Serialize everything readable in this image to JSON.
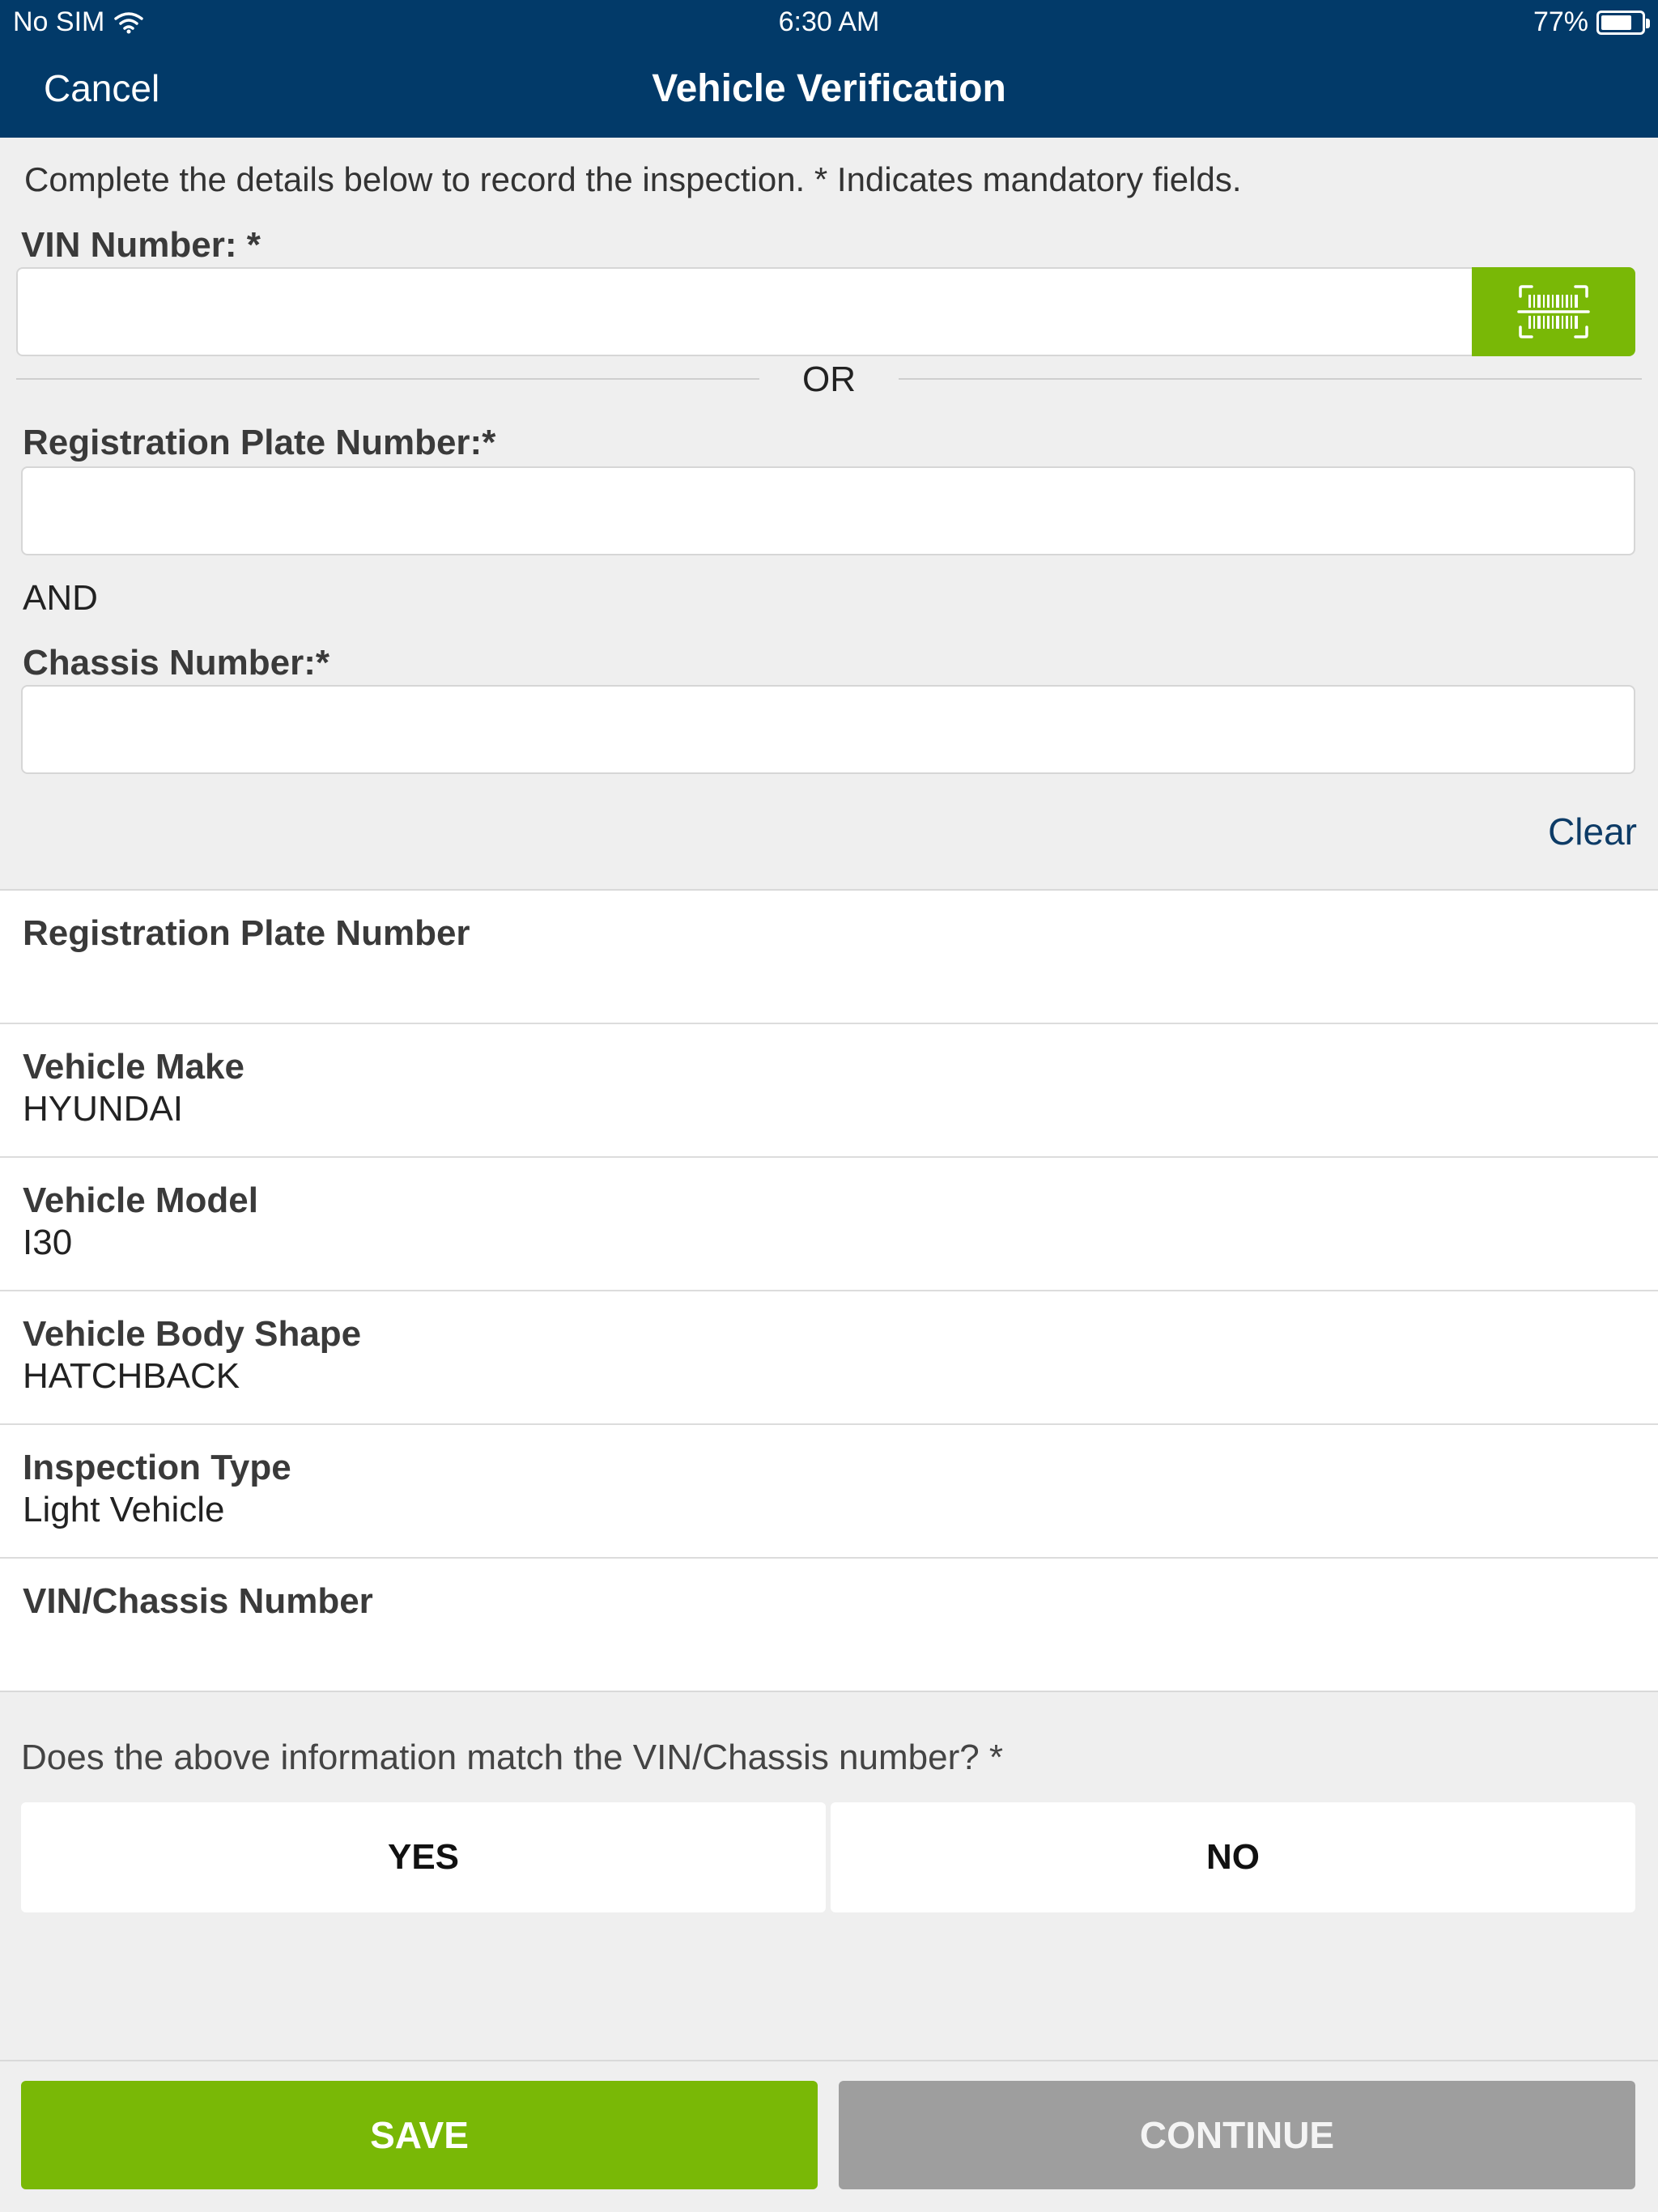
{
  "status_bar": {
    "carrier": "No SIM",
    "time": "6:30 AM",
    "battery": "77%",
    "battery_level": 0.77
  },
  "nav": {
    "cancel_label": "Cancel",
    "title": "Vehicle Verification"
  },
  "form": {
    "intro": "Complete the details below to record the inspection.  * Indicates mandatory fields.",
    "vin_label": "VIN Number: *",
    "vin_value": "",
    "or_text": "OR",
    "rego_label": "Registration Plate Number:*",
    "rego_value": "",
    "and_text": "AND",
    "chassis_label": "Chassis Number:*",
    "chassis_value": "",
    "clear_label": "Clear",
    "scan_icon": "barcode-scan-icon"
  },
  "info": {
    "rows": [
      {
        "label": "Registration Plate Number",
        "value": ""
      },
      {
        "label": "Vehicle Make",
        "value": "HYUNDAI"
      },
      {
        "label": "Vehicle Model",
        "value": "I30"
      },
      {
        "label": "Vehicle Body Shape",
        "value": "HATCHBACK"
      },
      {
        "label": "Inspection Type",
        "value": "Light Vehicle"
      },
      {
        "label": "VIN/Chassis Number",
        "value": ""
      }
    ]
  },
  "question": {
    "text": "Does the above information match the VIN/Chassis number? *",
    "yes_label": "YES",
    "no_label": "NO"
  },
  "actions": {
    "save_label": "SAVE",
    "continue_label": "CONTINUE"
  },
  "colors": {
    "nav_bg": "#023a69",
    "accent_green": "#79b806",
    "disabled_gray": "#9e9e9e",
    "link_blue": "#0d3b66"
  }
}
